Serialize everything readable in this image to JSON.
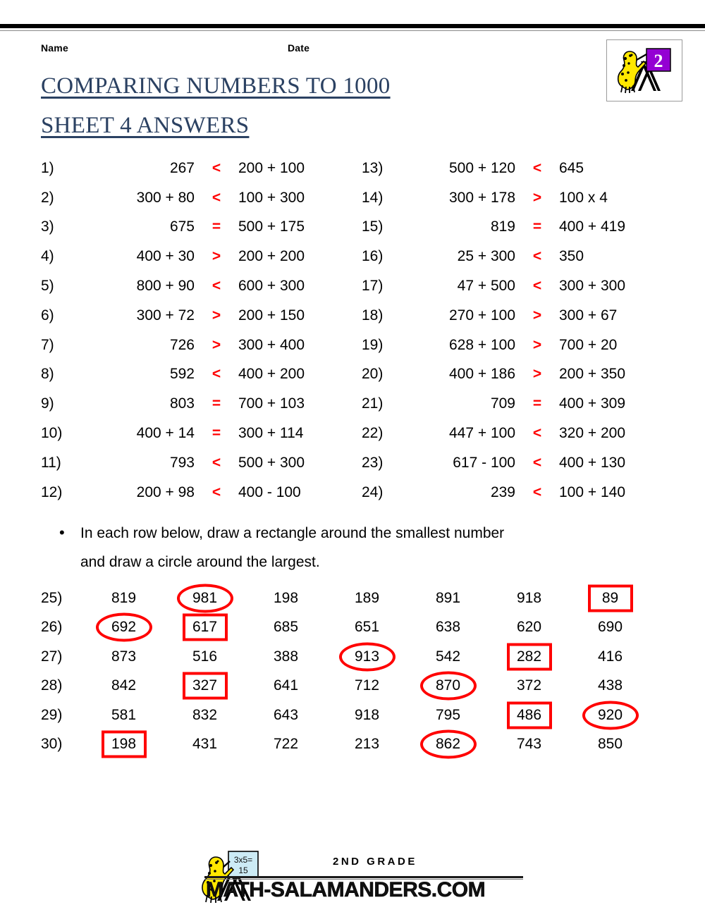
{
  "header": {
    "name_label": "Name",
    "date_label": "Date",
    "title_line1": "COMPARING NUMBERS TO 1000",
    "title_line2": "SHEET 4 ANSWERS",
    "grade_badge": "2"
  },
  "colors": {
    "title": "#2b4162",
    "answer_red": "#ff0000",
    "text": "#000000",
    "badge_purple": "#9400d3",
    "salamander_yellow": "#ffe800"
  },
  "problems": [
    {
      "num": "1)",
      "left": "267",
      "op": "<",
      "right": "200 + 100"
    },
    {
      "num": "2)",
      "left": "300 + 80",
      "op": "<",
      "right": "100 + 300"
    },
    {
      "num": "3)",
      "left": "675",
      "op": "=",
      "right": "500 + 175"
    },
    {
      "num": "4)",
      "left": "400 + 30",
      "op": ">",
      "right": "200 + 200"
    },
    {
      "num": "5)",
      "left": "800 + 90",
      "op": "<",
      "right": "600 + 300"
    },
    {
      "num": "6)",
      "left": "300 + 72",
      "op": ">",
      "right": "200 + 150"
    },
    {
      "num": "7)",
      "left": "726",
      "op": ">",
      "right": "300 + 400"
    },
    {
      "num": "8)",
      "left": "592",
      "op": "<",
      "right": "400 + 200"
    },
    {
      "num": "9)",
      "left": "803",
      "op": "=",
      "right": "700 + 103"
    },
    {
      "num": "10)",
      "left": "400 + 14",
      "op": "=",
      "right": "300 + 114"
    },
    {
      "num": "11)",
      "left": "793",
      "op": "<",
      "right": "500 + 300"
    },
    {
      "num": "12)",
      "left": "200 + 98",
      "op": "<",
      "right": "400 - 100"
    },
    {
      "num": "13)",
      "left": "500 + 120",
      "op": "<",
      "right": "645"
    },
    {
      "num": "14)",
      "left": "300 + 178",
      "op": ">",
      "right": "100 x 4"
    },
    {
      "num": "15)",
      "left": "819",
      "op": "=",
      "right": "400 + 419"
    },
    {
      "num": "16)",
      "left": "25 + 300",
      "op": "<",
      "right": "350"
    },
    {
      "num": "17)",
      "left": "47 + 500",
      "op": "<",
      "right": "300 + 300"
    },
    {
      "num": "18)",
      "left": "270 + 100",
      "op": ">",
      "right": "300 + 67"
    },
    {
      "num": "19)",
      "left": "628 + 100",
      "op": ">",
      "right": "700 + 20"
    },
    {
      "num": "20)",
      "left": "400 + 186",
      "op": ">",
      "right": "200 + 350"
    },
    {
      "num": "21)",
      "left": "709",
      "op": "=",
      "right": "400 + 309"
    },
    {
      "num": "22)",
      "left": "447 + 100",
      "op": "<",
      "right": "320 + 200"
    },
    {
      "num": "23)",
      "left": "617 - 100",
      "op": "<",
      "right": "400 + 130"
    },
    {
      "num": "24)",
      "left": "239",
      "op": "<",
      "right": "100 + 140"
    }
  ],
  "instruction": {
    "bullet": "•",
    "line1": "In each row below, draw a rectangle around the smallest number",
    "line2": "and draw a circle around the largest."
  },
  "number_rows": [
    {
      "label": "25)",
      "values": [
        "819",
        "981",
        "198",
        "189",
        "891",
        "918",
        "89"
      ],
      "marks": [
        "",
        "circle",
        "",
        "",
        "",
        "",
        "box"
      ]
    },
    {
      "label": "26)",
      "values": [
        "692",
        "617",
        "685",
        "651",
        "638",
        "620",
        "690"
      ],
      "marks": [
        "circle",
        "box",
        "",
        "",
        "",
        "",
        ""
      ]
    },
    {
      "label": "27)",
      "values": [
        "873",
        "516",
        "388",
        "913",
        "542",
        "282",
        "416"
      ],
      "marks": [
        "",
        "",
        "",
        "circle",
        "",
        "box",
        ""
      ]
    },
    {
      "label": "28)",
      "values": [
        "842",
        "327",
        "641",
        "712",
        "870",
        "372",
        "438"
      ],
      "marks": [
        "",
        "box",
        "",
        "",
        "circle",
        "",
        ""
      ]
    },
    {
      "label": "29)",
      "values": [
        "581",
        "832",
        "643",
        "918",
        "795",
        "486",
        "920"
      ],
      "marks": [
        "",
        "",
        "",
        "",
        "",
        "box",
        "circle"
      ]
    },
    {
      "label": "30)",
      "values": [
        "198",
        "431",
        "722",
        "213",
        "862",
        "743",
        "850"
      ],
      "marks": [
        "box",
        "",
        "",
        "",
        "circle",
        "",
        ""
      ]
    }
  ],
  "footer": {
    "grade_text": "2ND GRADE",
    "url_text": "MATH-SALAMANDERS.COM",
    "logo_board_text": "3x5=\n15"
  }
}
